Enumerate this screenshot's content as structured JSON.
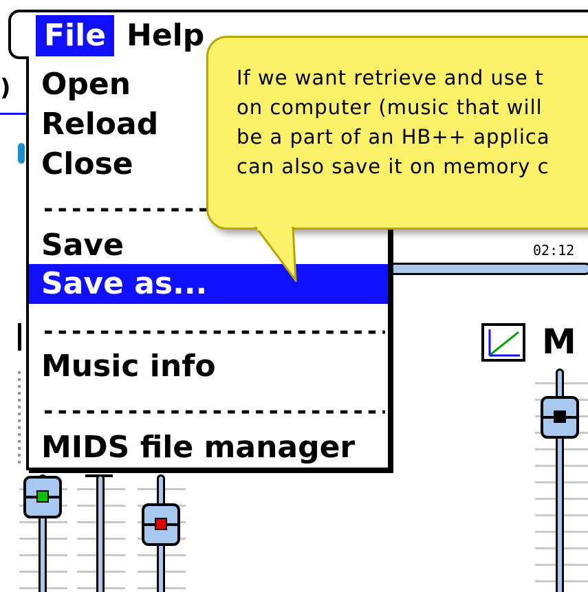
{
  "menubar": {
    "file_label": "File",
    "help_label": "Help"
  },
  "file_menu": {
    "items": [
      {
        "label": "Open"
      },
      {
        "label": "Reload"
      },
      {
        "label": "Close"
      },
      {
        "label": "Save"
      },
      {
        "label": "Save as..."
      },
      {
        "label": "Music info"
      },
      {
        "label": "MIDS file manager"
      }
    ],
    "selected": "Save as...",
    "separator": "---------------------------"
  },
  "tooltip": {
    "lines": [
      "If we want retrieve and use t",
      "on computer (music that will",
      "be a part of an HB++ applica",
      "can also save it on memory c"
    ]
  },
  "player": {
    "time": "02:12",
    "channel_label": "M"
  },
  "colors": {
    "menu_highlight": "#1010ff",
    "tooltip_bg": "#fcf26a",
    "slider_fill": "#a8c8f0",
    "green_led": "#00c000",
    "red_led": "#e00000"
  }
}
